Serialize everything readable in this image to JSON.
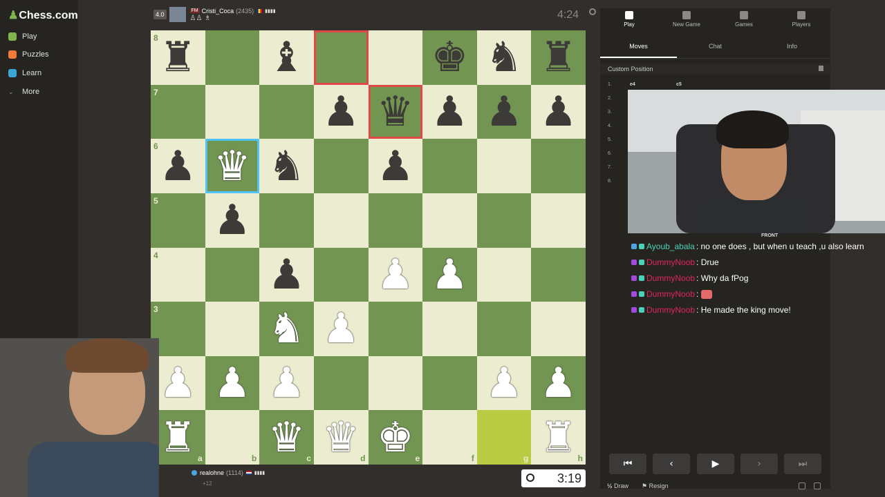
{
  "brand": {
    "logo": "Chess.com",
    "accent": "#81b64c"
  },
  "sidebar": {
    "items": [
      {
        "label": "Play",
        "icon": "play-icon",
        "color": "#81b64c"
      },
      {
        "label": "Puzzles",
        "icon": "puzzle-icon",
        "color": "#f07a3a"
      },
      {
        "label": "Learn",
        "icon": "learn-icon",
        "color": "#3aa6d6"
      },
      {
        "label": "More",
        "icon": "chevron-down-icon",
        "color": "#999"
      }
    ]
  },
  "top_player": {
    "rating_badge": "4.0",
    "title": "FM",
    "name": "Cristi_Coca",
    "rating": "(2435)",
    "captured": "♙♙ ♗",
    "clock": "4:24"
  },
  "bottom_player": {
    "name": "realohne",
    "rating": "(1114)",
    "material": "+12",
    "clock": "3:19"
  },
  "board": {
    "files": [
      "a",
      "b",
      "c",
      "d",
      "e",
      "f",
      "g",
      "h"
    ],
    "ranks": [
      "8",
      "7",
      "6",
      "5",
      "4",
      "3",
      "2",
      "1"
    ],
    "rows": [
      [
        "r",
        "",
        "b",
        "",
        "",
        "k",
        "n",
        "r"
      ],
      [
        "",
        "",
        "",
        "p",
        "q",
        "p",
        "p",
        "p"
      ],
      [
        "p",
        "Q",
        "n",
        "",
        "p",
        "",
        "",
        ""
      ],
      [
        "",
        "p",
        "",
        "",
        "",
        "",
        "",
        ""
      ],
      [
        "",
        "",
        "p",
        "",
        "P",
        "P",
        "",
        ""
      ],
      [
        "",
        "",
        "N",
        "P",
        "",
        "",
        "",
        ""
      ],
      [
        "P",
        "P",
        "P",
        "",
        "",
        "",
        "P",
        "P"
      ],
      [
        "R",
        "",
        "Q",
        "Q",
        "K",
        "",
        "",
        "R"
      ]
    ],
    "red_squares": [
      "d8",
      "e7"
    ],
    "cyan_squares": [
      "b6"
    ],
    "highlight_squares": [
      "g1"
    ]
  },
  "panel": {
    "top_nav": [
      {
        "label": "Play",
        "icon": "lightning-icon",
        "active": true
      },
      {
        "label": "New Game",
        "icon": "plus-square-icon",
        "active": false
      },
      {
        "label": "Games",
        "icon": "grid-icon",
        "active": false
      },
      {
        "label": "Players",
        "icon": "players-icon",
        "active": false
      }
    ],
    "tabs": [
      {
        "label": "Moves",
        "active": true
      },
      {
        "label": "Chat",
        "active": false
      },
      {
        "label": "Info",
        "active": false
      }
    ],
    "custom_position": "Custom Position",
    "move_numbers": [
      "1.",
      "2.",
      "3.",
      "4.",
      "5.",
      "6.",
      "7.",
      "8."
    ],
    "first_move": {
      "white": "e4",
      "black": "c5"
    },
    "draw_label": "Draw",
    "draw_prefix": "½",
    "resign_label": "Resign"
  },
  "webcam": {
    "label": "FRONT"
  },
  "chat": [
    {
      "user": "Ayoub_abala",
      "color": "#4dd0b8",
      "text": ": no one does , but when u teach ,u also learn",
      "emote": false
    },
    {
      "user": "DummyNoob",
      "color": "#e0245e",
      "text": ": Drue",
      "emote": false
    },
    {
      "user": "DummyNoob",
      "color": "#e0245e",
      "text": ": Why da fPog",
      "emote": false
    },
    {
      "user": "DummyNoob",
      "color": "#e0245e",
      "text": ":",
      "emote": true
    },
    {
      "user": "DummyNoob",
      "color": "#e0245e",
      "text": ": He made the king move!",
      "emote": false
    }
  ]
}
